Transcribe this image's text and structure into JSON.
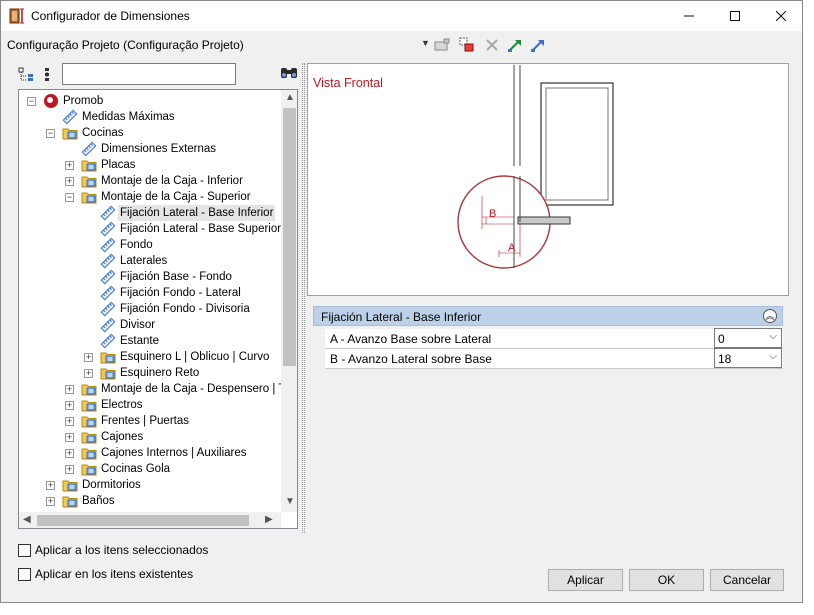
{
  "window": {
    "title": "Configurador de Dimensiones"
  },
  "config": {
    "label": "Configuração Projeto (Configuração Projeto)"
  },
  "search": {
    "value": "",
    "placeholder": ""
  },
  "tree": {
    "items": [
      {
        "label": "Promob",
        "level": 0,
        "exp": "minus",
        "icon": "promob-logo-icon"
      },
      {
        "label": "Medidas Máximas",
        "level": 1,
        "exp": "",
        "icon": "ruler-icon"
      },
      {
        "label": "Cocinas",
        "level": 1,
        "exp": "minus",
        "icon": "folder-icon"
      },
      {
        "label": "Dimensiones Externas",
        "level": 2,
        "exp": "",
        "icon": "ruler-icon"
      },
      {
        "label": "Placas",
        "level": 2,
        "exp": "plus",
        "icon": "folder-icon"
      },
      {
        "label": "Montaje de la Caja - Inferior",
        "level": 2,
        "exp": "plus",
        "icon": "folder-icon"
      },
      {
        "label": "Montaje de la Caja - Superior",
        "level": 2,
        "exp": "minus",
        "icon": "folder-icon"
      },
      {
        "label": "Fijación Lateral - Base Inferior",
        "level": 3,
        "exp": "",
        "icon": "ruler-icon",
        "selected": true
      },
      {
        "label": "Fijación Lateral - Base Superior",
        "level": 3,
        "exp": "",
        "icon": "ruler-icon"
      },
      {
        "label": "Fondo",
        "level": 3,
        "exp": "",
        "icon": "ruler-icon"
      },
      {
        "label": "Laterales",
        "level": 3,
        "exp": "",
        "icon": "ruler-icon"
      },
      {
        "label": " Fijación Base - Fondo",
        "level": 3,
        "exp": "",
        "icon": "ruler-icon"
      },
      {
        "label": "Fijación Fondo - Lateral",
        "level": 3,
        "exp": "",
        "icon": "ruler-icon"
      },
      {
        "label": "Fijación Fondo - Divisoria",
        "level": 3,
        "exp": "",
        "icon": "ruler-icon"
      },
      {
        "label": "Divisor",
        "level": 3,
        "exp": "",
        "icon": "ruler-icon"
      },
      {
        "label": "Estante",
        "level": 3,
        "exp": "",
        "icon": "ruler-icon"
      },
      {
        "label": "Esquinero L | Oblicuo | Curvo",
        "level": 3,
        "exp": "plus",
        "icon": "folder-icon"
      },
      {
        "label": "Esquinero Reto",
        "level": 3,
        "exp": "plus",
        "icon": "folder-icon"
      },
      {
        "label": "Montaje de la Caja - Despensero | Torre",
        "level": 2,
        "exp": "plus",
        "icon": "folder-icon"
      },
      {
        "label": "Electros",
        "level": 2,
        "exp": "plus",
        "icon": "folder-icon"
      },
      {
        "label": "Frentes | Puertas",
        "level": 2,
        "exp": "plus",
        "icon": "folder-icon"
      },
      {
        "label": "Cajones",
        "level": 2,
        "exp": "plus",
        "icon": "folder-icon"
      },
      {
        "label": "Cajones Internos | Auxiliares",
        "level": 2,
        "exp": "plus",
        "icon": "folder-icon"
      },
      {
        "label": "Cocinas Gola",
        "level": 2,
        "exp": "plus",
        "icon": "folder-icon"
      },
      {
        "label": "Dormitorios",
        "level": 1,
        "exp": "plus",
        "icon": "folder-icon"
      },
      {
        "label": "Baños",
        "level": 1,
        "exp": "plus",
        "icon": "folder-icon"
      }
    ]
  },
  "preview": {
    "title": "Vista Frontal",
    "dim_a": "A",
    "dim_b": "B",
    "accent_color": "#c0141e"
  },
  "properties": {
    "header": "Fijación Lateral - Base Inferior",
    "rows": [
      {
        "label": "A - Avanzo Base sobre Lateral",
        "value": "0"
      },
      {
        "label": "B - Avanzo Lateral sobre Base",
        "value": "18"
      }
    ]
  },
  "options": {
    "apply_selected": "Aplicar a los itens seleccionados",
    "apply_existing": "Aplicar en los itens existentes"
  },
  "buttons": {
    "apply": "Aplicar",
    "ok": "OK",
    "cancel": "Cancelar"
  }
}
